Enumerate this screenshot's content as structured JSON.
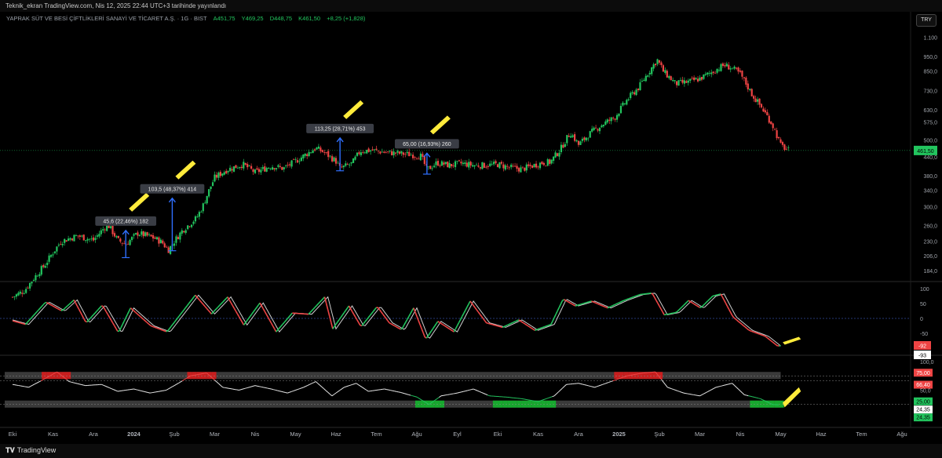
{
  "header": {
    "publish_text": "Teknik_ekran TradingView.com, Nis 12, 2025 22:44 UTC+3 tarihinde yayınlandı",
    "symbol": "YAPRAK SÜT VE BESİ ÇİFTLİKLERİ SANAYİ VE TİCARET A.Ş. · 1G · BIST",
    "open": "A451,75",
    "high": "Y469,25",
    "low": "D448,75",
    "close": "K461,50",
    "change": "+8,25 (+1,828)",
    "currency": "TRY"
  },
  "footer": {
    "brand": "TradingView"
  },
  "colors": {
    "up": "#22c55e",
    "down": "#ef4444",
    "arrow": "#2f6fff",
    "highlight": "#ffeb3b",
    "osc_line": "#cfcfcf"
  },
  "chart_data": [
    {
      "type": "candlestick",
      "log_scale": true,
      "ylim": [
        170,
        1150
      ],
      "price_ticks": [
        1100,
        950,
        850,
        730,
        630,
        575,
        500,
        440,
        380,
        340,
        300,
        260,
        230,
        206,
        184
      ],
      "price_tick_labels": [
        "1.100",
        "950,0",
        "850,0",
        "730,0",
        "630,0",
        "575,0",
        "500,0",
        "440,0",
        "380,0",
        "340,0",
        "300,0",
        "260,0",
        "230,0",
        "206,0",
        "184,0"
      ],
      "last_price_label": "461,50",
      "last_price": 461.5,
      "x_labels": [
        "Eki",
        "Kas",
        "Ara",
        "2024",
        "Şub",
        "Mar",
        "Nis",
        "May",
        "Haz",
        "Tem",
        "Ağu",
        "Eyl",
        "Eki",
        "Kas",
        "Ara",
        "2025",
        "Şub",
        "Mar",
        "Nis",
        "May",
        "Haz",
        "Tem",
        "Ağu"
      ],
      "x_label_months": [
        0,
        1,
        2,
        3,
        4,
        5,
        6,
        7,
        8,
        9,
        10,
        11,
        12,
        13,
        14,
        15,
        16,
        17,
        18,
        19,
        20,
        21,
        22
      ],
      "price_path": [
        [
          0.0,
          150
        ],
        [
          0.3,
          158
        ],
        [
          0.8,
          192
        ],
        [
          1.2,
          230
        ],
        [
          1.6,
          240
        ],
        [
          2.0,
          232
        ],
        [
          2.35,
          262
        ],
        [
          2.6,
          232
        ],
        [
          2.8,
          225
        ],
        [
          3.1,
          245
        ],
        [
          3.5,
          236
        ],
        [
          3.7,
          228
        ],
        [
          3.85,
          215
        ],
        [
          4.2,
          250
        ],
        [
          4.55,
          275
        ],
        [
          4.7,
          300
        ],
        [
          5.0,
          375
        ],
        [
          5.3,
          398
        ],
        [
          5.7,
          415
        ],
        [
          6.0,
          390
        ],
        [
          6.4,
          410
        ],
        [
          6.7,
          402
        ],
        [
          7.0,
          425
        ],
        [
          7.3,
          452
        ],
        [
          7.5,
          470
        ],
        [
          7.7,
          455
        ],
        [
          8.0,
          425
        ],
        [
          8.1,
          402
        ],
        [
          8.4,
          418
        ],
        [
          8.6,
          460
        ],
        [
          8.9,
          462
        ],
        [
          9.2,
          455
        ],
        [
          9.5,
          452
        ],
        [
          9.8,
          448
        ],
        [
          10.1,
          442
        ],
        [
          10.25,
          398
        ],
        [
          10.5,
          420
        ],
        [
          10.8,
          412
        ],
        [
          11.1,
          418
        ],
        [
          11.4,
          412
        ],
        [
          11.7,
          412
        ],
        [
          12.0,
          415
        ],
        [
          12.3,
          405
        ],
        [
          12.6,
          400
        ],
        [
          12.9,
          412
        ],
        [
          13.1,
          420
        ],
        [
          13.3,
          422
        ],
        [
          13.55,
          465
        ],
        [
          13.8,
          530
        ],
        [
          14.0,
          482
        ],
        [
          14.3,
          528
        ],
        [
          14.6,
          565
        ],
        [
          14.9,
          595
        ],
        [
          15.2,
          680
        ],
        [
          15.5,
          752
        ],
        [
          15.75,
          848
        ],
        [
          15.95,
          925
        ],
        [
          16.1,
          845
        ],
        [
          16.4,
          770
        ],
        [
          16.7,
          780
        ],
        [
          17.0,
          800
        ],
        [
          17.3,
          842
        ],
        [
          17.6,
          888
        ],
        [
          17.8,
          868
        ],
        [
          18.0,
          828
        ],
        [
          18.3,
          705
        ],
        [
          18.6,
          620
        ],
        [
          18.8,
          560
        ],
        [
          19.0,
          480
        ],
        [
          19.2,
          461.5
        ]
      ],
      "measurements": [
        {
          "label": "45,6 (22,46%) 182",
          "x": 2.8,
          "from": 203,
          "to": 250
        },
        {
          "label": "103,5 (48,37%) 414",
          "x": 3.95,
          "from": 214,
          "to": 320
        },
        {
          "label": "113,25 (28,71%) 453",
          "x": 8.1,
          "from": 395,
          "to": 508
        },
        {
          "label": "65,00 (16,93%) 260",
          "x": 10.25,
          "from": 385,
          "to": 452
        }
      ]
    },
    {
      "type": "line",
      "name_shown": false,
      "ylim": [
        -100,
        100
      ],
      "ticks": [
        100,
        50,
        0,
        -50
      ],
      "tick_labels": [
        "100",
        "50",
        "0",
        "-50"
      ],
      "last_values": [
        -92,
        -93
      ],
      "last_value_labels": [
        "-92",
        "-93"
      ],
      "path": [
        [
          0.0,
          -5
        ],
        [
          0.4,
          -20
        ],
        [
          0.9,
          55
        ],
        [
          1.3,
          25
        ],
        [
          1.6,
          62
        ],
        [
          1.9,
          -15
        ],
        [
          2.3,
          45
        ],
        [
          2.7,
          -48
        ],
        [
          3.0,
          35
        ],
        [
          3.5,
          -25
        ],
        [
          3.9,
          -45
        ],
        [
          4.6,
          78
        ],
        [
          5.0,
          15
        ],
        [
          5.4,
          72
        ],
        [
          5.8,
          -22
        ],
        [
          6.2,
          52
        ],
        [
          6.6,
          -45
        ],
        [
          7.0,
          18
        ],
        [
          7.4,
          14
        ],
        [
          7.8,
          72
        ],
        [
          8.0,
          -35
        ],
        [
          8.4,
          42
        ],
        [
          8.7,
          -28
        ],
        [
          9.1,
          40
        ],
        [
          9.4,
          -15
        ],
        [
          9.7,
          -38
        ],
        [
          10.0,
          35
        ],
        [
          10.3,
          -70
        ],
        [
          10.6,
          -10
        ],
        [
          11.0,
          -45
        ],
        [
          11.4,
          58
        ],
        [
          11.8,
          -15
        ],
        [
          12.2,
          -30
        ],
        [
          12.6,
          -5
        ],
        [
          13.0,
          -40
        ],
        [
          13.4,
          -20
        ],
        [
          13.7,
          65
        ],
        [
          14.0,
          42
        ],
        [
          14.4,
          58
        ],
        [
          14.8,
          35
        ],
        [
          15.2,
          60
        ],
        [
          15.6,
          80
        ],
        [
          15.9,
          85
        ],
        [
          16.2,
          12
        ],
        [
          16.5,
          20
        ],
        [
          16.8,
          60
        ],
        [
          17.1,
          35
        ],
        [
          17.4,
          75
        ],
        [
          17.6,
          82
        ],
        [
          17.9,
          5
        ],
        [
          18.3,
          -40
        ],
        [
          18.7,
          -60
        ],
        [
          19.0,
          -92
        ]
      ]
    },
    {
      "type": "line",
      "name_shown": false,
      "ylim": [
        0,
        100
      ],
      "ticks": [
        100,
        50
      ],
      "tick_labels": [
        "100,0",
        "50,0"
      ],
      "level_labels": [
        "75,00",
        "66,40",
        "25,00",
        "24,35",
        "24,35"
      ],
      "levels": [
        75,
        66.4,
        25
      ],
      "last_value": 24.35,
      "path": [
        [
          0.0,
          60
        ],
        [
          0.4,
          55
        ],
        [
          0.8,
          70
        ],
        [
          1.1,
          82
        ],
        [
          1.4,
          65
        ],
        [
          1.8,
          58
        ],
        [
          2.2,
          60
        ],
        [
          2.6,
          48
        ],
        [
          3.0,
          52
        ],
        [
          3.4,
          45
        ],
        [
          3.8,
          50
        ],
        [
          4.1,
          62
        ],
        [
          4.4,
          75
        ],
        [
          4.8,
          80
        ],
        [
          5.2,
          55
        ],
        [
          5.6,
          50
        ],
        [
          6.0,
          58
        ],
        [
          6.4,
          52
        ],
        [
          6.8,
          45
        ],
        [
          7.2,
          55
        ],
        [
          7.5,
          65
        ],
        [
          7.9,
          40
        ],
        [
          8.2,
          55
        ],
        [
          8.5,
          62
        ],
        [
          8.8,
          48
        ],
        [
          9.2,
          52
        ],
        [
          9.6,
          46
        ],
        [
          10.0,
          38
        ],
        [
          10.3,
          25
        ],
        [
          10.6,
          40
        ],
        [
          11.0,
          45
        ],
        [
          11.4,
          52
        ],
        [
          11.8,
          40
        ],
        [
          12.2,
          38
        ],
        [
          12.6,
          35
        ],
        [
          13.0,
          30
        ],
        [
          13.4,
          40
        ],
        [
          13.7,
          60
        ],
        [
          14.0,
          62
        ],
        [
          14.4,
          55
        ],
        [
          14.8,
          65
        ],
        [
          15.2,
          75
        ],
        [
          15.6,
          80
        ],
        [
          15.9,
          82
        ],
        [
          16.2,
          55
        ],
        [
          16.6,
          45
        ],
        [
          17.0,
          40
        ],
        [
          17.4,
          55
        ],
        [
          17.8,
          62
        ],
        [
          18.1,
          42
        ],
        [
          18.5,
          35
        ],
        [
          18.8,
          25
        ],
        [
          19.0,
          24.35
        ]
      ]
    }
  ]
}
